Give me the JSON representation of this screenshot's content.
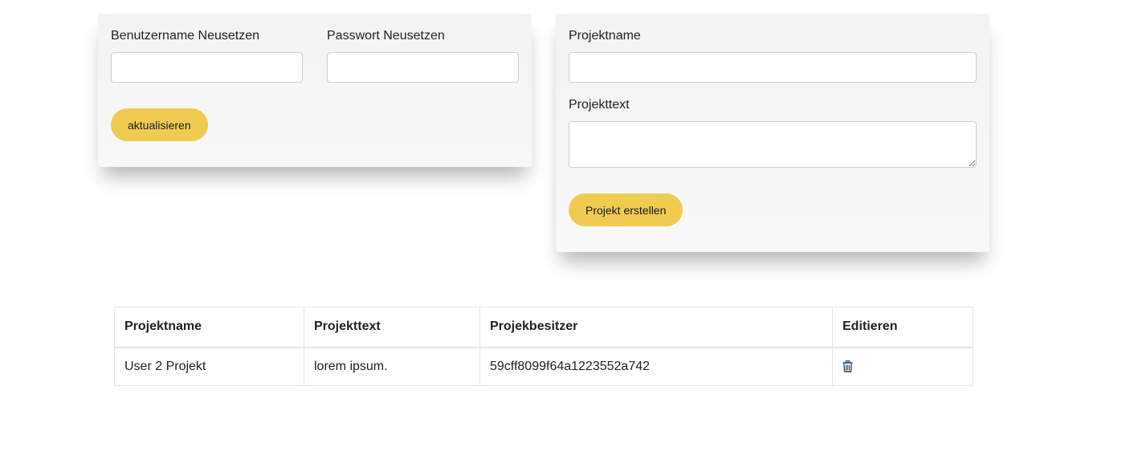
{
  "user_form": {
    "username_label": "Benutzername Neusetzen",
    "username_value": "",
    "password_label": "Passwort Neusetzen",
    "password_value": "",
    "submit_label": "aktualisieren"
  },
  "project_form": {
    "name_label": "Projektname",
    "name_value": "",
    "text_label": "Projekttext",
    "text_value": "",
    "submit_label": "Projekt erstellen"
  },
  "table": {
    "headers": [
      "Projektname",
      "Projekttext",
      "Projekbesitzer",
      "Editieren"
    ],
    "rows": [
      {
        "name": "User 2 Projekt",
        "text": "lorem ipsum.",
        "owner": "59cff8099f64a1223552a742",
        "action_icon": "trash-icon"
      }
    ]
  },
  "colors": {
    "button": "#f0cb52",
    "icon": "#2c4a66"
  }
}
